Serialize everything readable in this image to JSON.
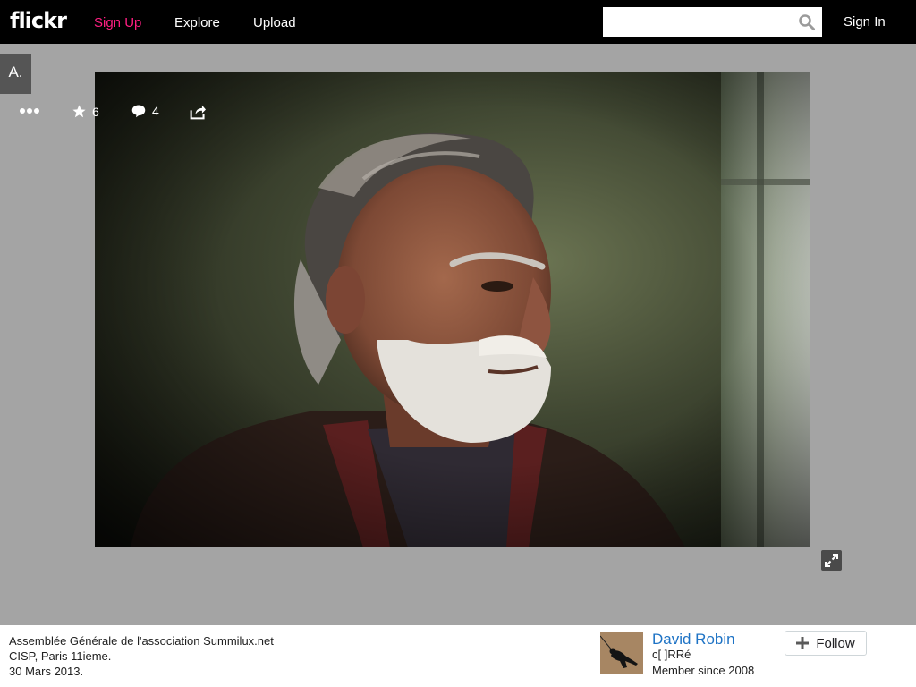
{
  "header": {
    "logo": "flickr",
    "nav": {
      "signup": "Sign Up",
      "explore": "Explore",
      "upload": "Upload"
    },
    "search": {
      "placeholder": "",
      "value": ""
    },
    "signin": "Sign In"
  },
  "stage": {
    "avatar_chip": "A.",
    "actions": {
      "faves_count": "6",
      "comments_count": "4"
    }
  },
  "footer": {
    "description": [
      "Assemblée Générale de l'association Summilux.net",
      "CISP, Paris 11ieme.",
      "30 Mars 2013."
    ],
    "owner": {
      "name": "David Robin",
      "handle": "c[ ]RRé",
      "member_since": "Member since 2008"
    },
    "follow_label": "Follow"
  },
  "colors": {
    "brand_pink": "#ff1f82",
    "link_blue": "#1e73c5",
    "stage_gray": "#a4a4a4"
  }
}
